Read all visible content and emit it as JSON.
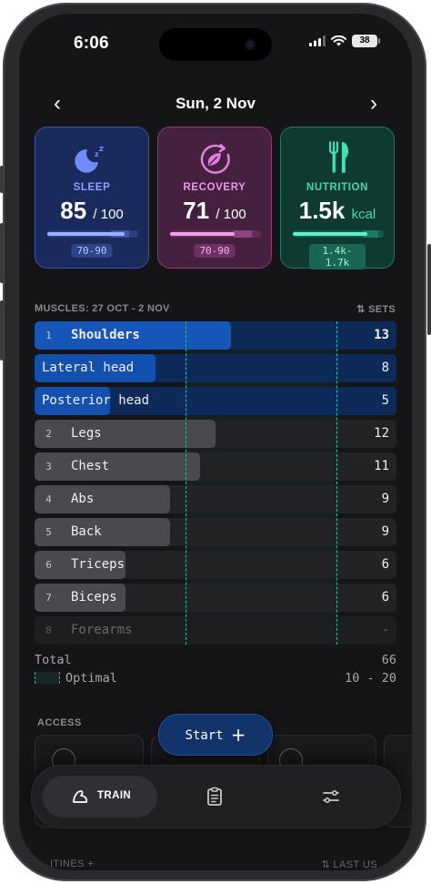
{
  "status": {
    "time": "6:06",
    "battery": "38"
  },
  "date_nav": {
    "prev": "‹",
    "date": "Sun, 2 Nov",
    "next": "›"
  },
  "cards": {
    "sleep": {
      "title": "SLEEP",
      "value": "85",
      "max": "/ 100",
      "range": "70-90",
      "progress": 0.85,
      "optimal": [
        0.7,
        0.9
      ],
      "accent": "#7f9bff"
    },
    "recovery": {
      "title": "RECOVERY",
      "value": "71",
      "max": "/ 100",
      "range": "70-90",
      "progress": 0.71,
      "optimal": [
        0.7,
        0.9
      ],
      "accent": "#e07fe0"
    },
    "nutrition": {
      "title": "NUTRITION",
      "value": "1.5k",
      "unit": "kcal",
      "range": "1.4k-1.7k",
      "progress": 0.82,
      "optimal": [
        0.77,
        0.94
      ],
      "accent": "#3fe0b4"
    }
  },
  "muscles": {
    "header": "MUSCLES: 27 OCT - 2 NOV",
    "sets_label": "SETS",
    "optimal_range": [
      10,
      20
    ],
    "scale_max": 24,
    "rows": [
      {
        "rank": "1",
        "name": "Shoulders",
        "count": "13",
        "value": 13,
        "style": "primary"
      },
      {
        "rank": "",
        "name": "Lateral head",
        "count": "8",
        "value": 8,
        "style": "sub"
      },
      {
        "rank": "",
        "name": "Posterior head",
        "count": "5",
        "value": 5,
        "style": "sub"
      },
      {
        "rank": "2",
        "name": "Legs",
        "count": "12",
        "value": 12,
        "style": "normal"
      },
      {
        "rank": "3",
        "name": "Chest",
        "count": "11",
        "value": 11,
        "style": "normal"
      },
      {
        "rank": "4",
        "name": "Abs",
        "count": "9",
        "value": 9,
        "style": "normal"
      },
      {
        "rank": "5",
        "name": "Back",
        "count": "9",
        "value": 9,
        "style": "normal"
      },
      {
        "rank": "6",
        "name": "Triceps",
        "count": "6",
        "value": 6,
        "style": "normal"
      },
      {
        "rank": "7",
        "name": "Biceps",
        "count": "6",
        "value": 6,
        "style": "normal"
      },
      {
        "rank": "8",
        "name": "Forearms",
        "count": "-",
        "value": 0,
        "style": "dim"
      }
    ],
    "total_label": "Total",
    "total_value": "66",
    "optimal_label": "Optimal",
    "optimal_text": "10 - 20"
  },
  "access": {
    "label": "ACCESS"
  },
  "start_button": {
    "label": "Start"
  },
  "nav": {
    "train_label": "TRAIN"
  },
  "bottom_peek": {
    "left": "ITINES +",
    "right": "⇅ LAST US"
  }
}
